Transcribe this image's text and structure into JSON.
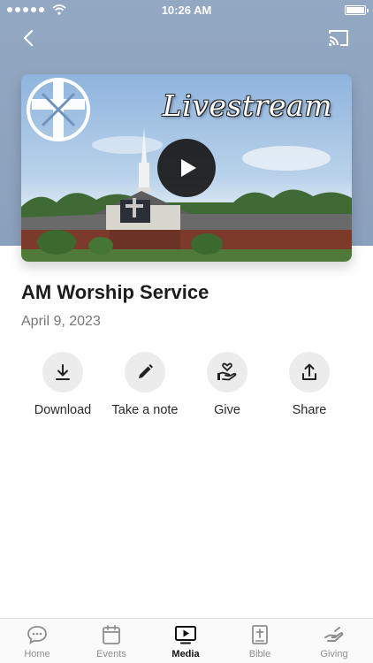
{
  "status_bar": {
    "time": "10:26 AM"
  },
  "video": {
    "overlay_text": "Livestream"
  },
  "sermon": {
    "title": "AM Worship Service",
    "date": "April 9, 2023"
  },
  "actions": [
    {
      "label": "Download",
      "icon": "download-icon"
    },
    {
      "label": "Take a note",
      "icon": "pencil-icon"
    },
    {
      "label": "Give",
      "icon": "hand-heart-icon"
    },
    {
      "label": "Share",
      "icon": "share-icon"
    }
  ],
  "tabs": [
    {
      "label": "Home",
      "icon": "chat-bubble-icon",
      "active": false
    },
    {
      "label": "Events",
      "icon": "calendar-icon",
      "active": false
    },
    {
      "label": "Media",
      "icon": "play-screen-icon",
      "active": true
    },
    {
      "label": "Bible",
      "icon": "bible-icon",
      "active": false
    },
    {
      "label": "Giving",
      "icon": "giving-hand-icon",
      "active": false
    }
  ],
  "colors": {
    "header_band": "#8aa0bc",
    "action_circle": "#ececec",
    "active_tab": "#111111",
    "inactive_tab": "#8d8d8d"
  }
}
